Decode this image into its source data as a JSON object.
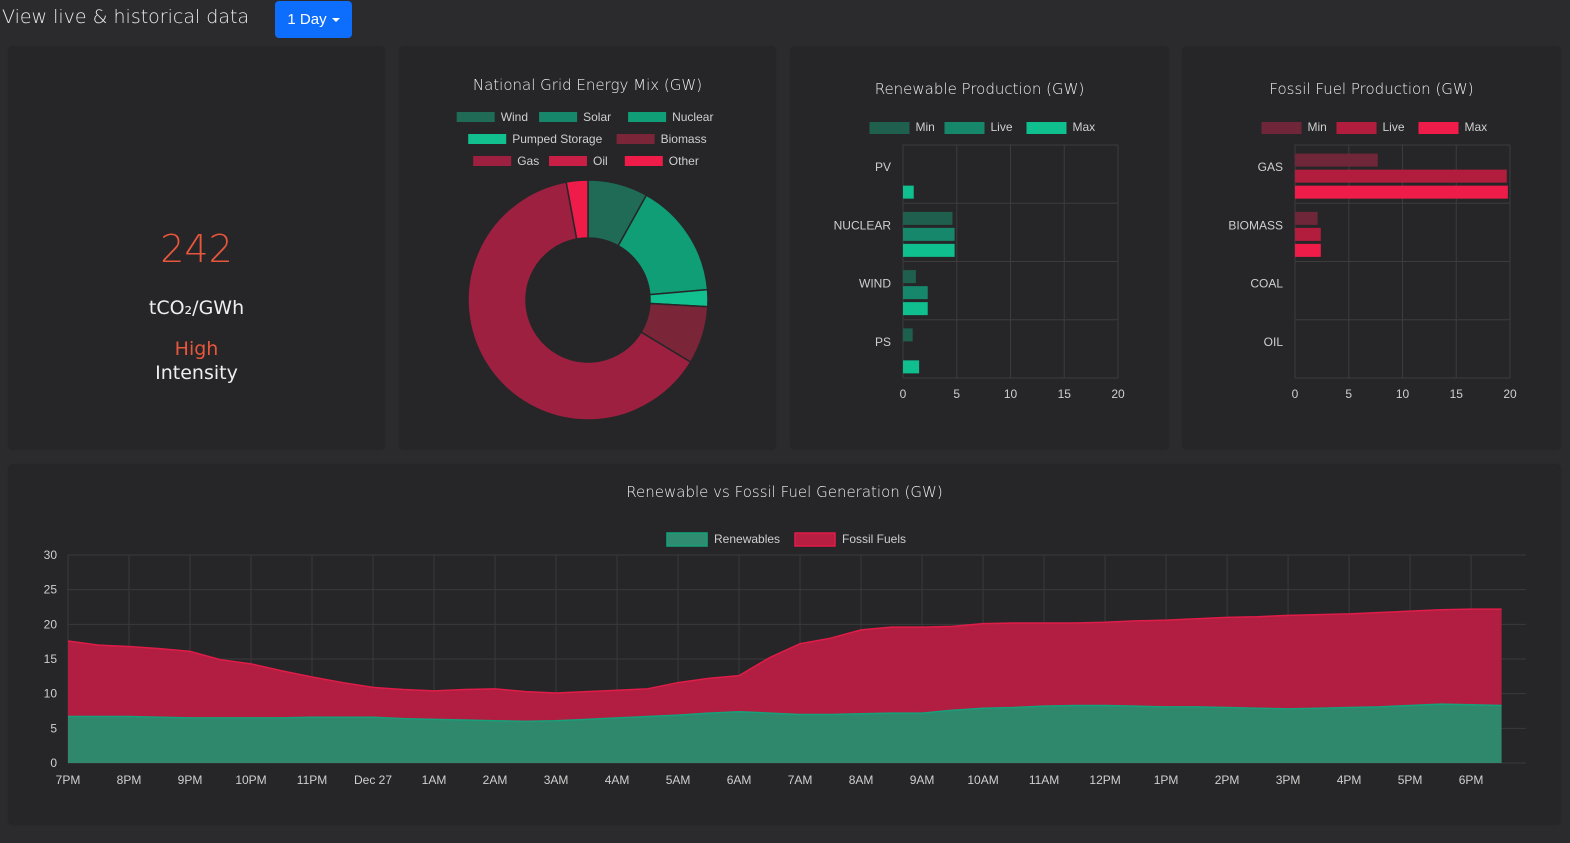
{
  "header": {
    "title": "View live & historical data",
    "range_button": "1 Day"
  },
  "intensity": {
    "value": "242",
    "unit": "tCO₂/GWh",
    "level": "High",
    "word": "Intensity",
    "level_color": "#e8563b"
  },
  "colors": {
    "renewable_min": "#1f5f4e",
    "renewable_live": "#17876b",
    "renewable_max": "#0fbf8e",
    "fossil_min": "#6f2639",
    "fossil_live": "#b21d3e",
    "fossil_max": "#ef1c4a",
    "button": "#0d6efd"
  },
  "chart_data": [
    {
      "type": "pie",
      "title": "National Grid Energy Mix (GW)",
      "legend_rows": [
        [
          "Wind",
          "Solar",
          "Nuclear"
        ],
        [
          "Pumped Storage",
          "Biomass"
        ],
        [
          "Gas",
          "Oil",
          "Other"
        ]
      ],
      "categories": [
        "Wind",
        "Solar",
        "Nuclear",
        "Pumped Storage",
        "Biomass",
        "Gas",
        "Oil",
        "Other"
      ],
      "values": [
        2.5,
        0,
        4.8,
        0.7,
        2.4,
        19.6,
        0,
        0.9
      ],
      "colors": [
        "#1f6b55",
        "#16876a",
        "#0f9e76",
        "#11c08e",
        "#7b2539",
        "#9e2040",
        "#c91f47",
        "#ef1c4a"
      ]
    },
    {
      "type": "bar",
      "orientation": "horizontal",
      "title": "Renewable Production (GW)",
      "categories": [
        "PV",
        "NUCLEAR",
        "WIND",
        "PS"
      ],
      "series": [
        {
          "name": "Min",
          "values": [
            0,
            4.6,
            1.2,
            0.9
          ]
        },
        {
          "name": "Live",
          "values": [
            0,
            4.8,
            2.3,
            0
          ]
        },
        {
          "name": "Max",
          "values": [
            1.0,
            4.8,
            2.3,
            1.5
          ]
        }
      ],
      "xlim": [
        0,
        20
      ],
      "xticks": [
        0,
        5,
        10,
        15,
        20
      ],
      "legend": "top"
    },
    {
      "type": "bar",
      "orientation": "horizontal",
      "title": "Fossil Fuel Production (GW)",
      "categories": [
        "GAS",
        "BIOMASS",
        "COAL",
        "OIL"
      ],
      "series": [
        {
          "name": "Min",
          "values": [
            7.7,
            2.1,
            0,
            0
          ]
        },
        {
          "name": "Live",
          "values": [
            19.7,
            2.4,
            0,
            0
          ]
        },
        {
          "name": "Max",
          "values": [
            19.8,
            2.4,
            0,
            0
          ]
        }
      ],
      "xlim": [
        0,
        20
      ],
      "xticks": [
        0,
        5,
        10,
        15,
        20
      ],
      "legend": "top"
    },
    {
      "type": "area",
      "stacked": true,
      "title": "Renewable vs Fossil Fuel Generation (GW)",
      "x_labels": [
        "7PM",
        "8PM",
        "9PM",
        "10PM",
        "11PM",
        "Dec 27",
        "1AM",
        "2AM",
        "3AM",
        "4AM",
        "5AM",
        "6AM",
        "7AM",
        "8AM",
        "9AM",
        "10AM",
        "11AM",
        "12PM",
        "1PM",
        "2PM",
        "3PM",
        "4PM",
        "5PM",
        "6PM"
      ],
      "x": [
        0,
        0.5,
        1,
        1.5,
        2,
        2.5,
        3,
        3.5,
        4,
        4.5,
        5,
        5.5,
        6,
        6.5,
        7,
        7.5,
        8,
        8.5,
        9,
        9.5,
        10,
        10.5,
        11,
        11.5,
        12,
        12.5,
        13,
        13.5,
        14,
        14.5,
        15,
        15.5,
        16,
        16.5,
        17,
        17.5,
        18,
        18.5,
        19,
        19.5,
        20,
        20.5,
        21,
        21.5,
        22,
        22.5,
        23,
        23.5
      ],
      "series": [
        {
          "name": "Renewables",
          "values": [
            6.7,
            6.7,
            6.7,
            6.6,
            6.5,
            6.5,
            6.5,
            6.5,
            6.6,
            6.6,
            6.6,
            6.4,
            6.3,
            6.2,
            6.1,
            6.0,
            6.1,
            6.3,
            6.5,
            6.7,
            6.9,
            7.2,
            7.4,
            7.2,
            7.0,
            7.0,
            7.1,
            7.2,
            7.2,
            7.6,
            7.9,
            8.0,
            8.2,
            8.3,
            8.3,
            8.2,
            8.1,
            8.1,
            8.0,
            7.9,
            7.8,
            7.9,
            8.0,
            8.1,
            8.3,
            8.5,
            8.4,
            8.3
          ]
        },
        {
          "name": "Fossil Fuels",
          "values": [
            10.9,
            10.3,
            10.1,
            9.9,
            9.6,
            8.4,
            7.8,
            6.8,
            5.8,
            5.0,
            4.3,
            4.2,
            4.1,
            4.4,
            4.6,
            4.3,
            4.0,
            4.0,
            4.0,
            4.0,
            4.7,
            5.0,
            5.2,
            8.0,
            10.2,
            11.0,
            12.1,
            12.4,
            12.4,
            12.1,
            12.2,
            12.2,
            12.0,
            11.9,
            12.0,
            12.3,
            12.5,
            12.7,
            13.0,
            13.2,
            13.5,
            13.5,
            13.5,
            13.6,
            13.6,
            13.6,
            13.8,
            13.9
          ]
        }
      ],
      "colors": [
        "#2f8c70",
        "#b81d42"
      ],
      "ylim": [
        0,
        30
      ],
      "yticks": [
        0,
        5,
        10,
        15,
        20,
        25,
        30
      ],
      "legend": "top",
      "grid": true
    }
  ]
}
